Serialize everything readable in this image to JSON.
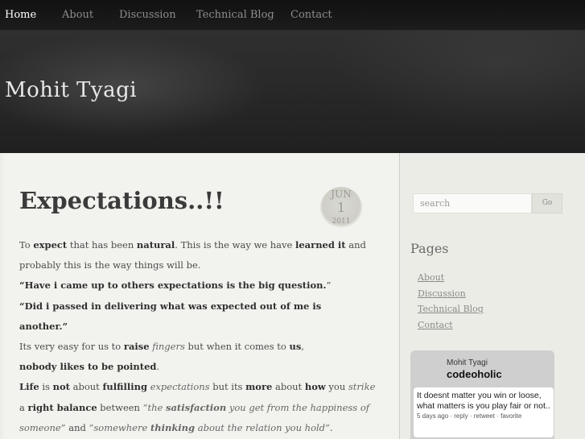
{
  "nav": {
    "items": [
      {
        "label": "Home"
      },
      {
        "label": "About"
      },
      {
        "label": "Discussion"
      },
      {
        "label": "Technical Blog"
      },
      {
        "label": "Contact"
      }
    ]
  },
  "header": {
    "site_title": "Mohit Tyagi"
  },
  "post": {
    "title": "Expectations..!!",
    "date": {
      "month": "JUN",
      "day": "1",
      "year": "2011"
    },
    "lines": [
      [
        {
          "t": "To "
        },
        {
          "t": "expect",
          "b": true
        },
        {
          "t": " that has been "
        },
        {
          "t": "natural",
          "b": true
        },
        {
          "t": ". This is the way we have "
        },
        {
          "t": "learned it",
          "b": true
        },
        {
          "t": " and"
        }
      ],
      [
        {
          "t": "probably this is the way things will be."
        }
      ],
      [
        {
          "t": "“Have i came up to others expectations is the big question.",
          "b": true
        },
        {
          "t": "”"
        }
      ],
      [
        {
          "t": "“Did i passed in delivering what was expected out of me is",
          "b": true
        }
      ],
      [
        {
          "t": "another.”",
          "b": true
        }
      ],
      [
        {
          "t": "Its very easy for us to "
        },
        {
          "t": "raise",
          "b": true
        },
        {
          "t": " "
        },
        {
          "t": "fingers",
          "i": true
        },
        {
          "t": " but when it comes to "
        },
        {
          "t": "us",
          "b": true
        },
        {
          "t": ","
        }
      ],
      [
        {
          "t": "nobody likes to be pointed",
          "b": true
        },
        {
          "t": "."
        }
      ],
      [
        {
          "t": "Life",
          "b": true
        },
        {
          "t": " is "
        },
        {
          "t": "not",
          "b": true
        },
        {
          "t": " about "
        },
        {
          "t": "fulfilling",
          "b": true
        },
        {
          "t": " "
        },
        {
          "t": "expectations",
          "i": true
        },
        {
          "t": " but its "
        },
        {
          "t": "more",
          "b": true
        },
        {
          "t": " about "
        },
        {
          "t": "how",
          "b": true
        },
        {
          "t": " you "
        },
        {
          "t": "strike",
          "i": true
        }
      ],
      [
        {
          "t": "a "
        },
        {
          "t": "right balance",
          "b": true
        },
        {
          "t": " between "
        },
        {
          "t": "“the ",
          "i": true
        },
        {
          "t": "satisfaction",
          "i": true,
          "b": true
        },
        {
          "t": " you get from the happiness of",
          "i": true
        }
      ],
      [
        {
          "t": "someone”",
          "i": true
        },
        {
          "t": " and "
        },
        {
          "t": "“somewhere ",
          "i": true
        },
        {
          "t": "thinking",
          "i": true,
          "b": true
        },
        {
          "t": " about the relation you hold”",
          "i": true
        },
        {
          "t": "."
        }
      ]
    ]
  },
  "sidebar": {
    "search": {
      "placeholder": "search",
      "button_label": "Go"
    },
    "pages_heading": "Pages",
    "pages": [
      {
        "label": "About"
      },
      {
        "label": "Discussion"
      },
      {
        "label": "Technical Blog"
      },
      {
        "label": "Contact"
      }
    ],
    "twitter": {
      "name": "Mohit Tyagi",
      "handle": "codeoholic",
      "tweet": "It doesnt matter you win or loose, what matters is you play fair or not..",
      "time": "5 days ago",
      "actions": [
        "reply",
        "retweet",
        "favorite"
      ]
    }
  }
}
